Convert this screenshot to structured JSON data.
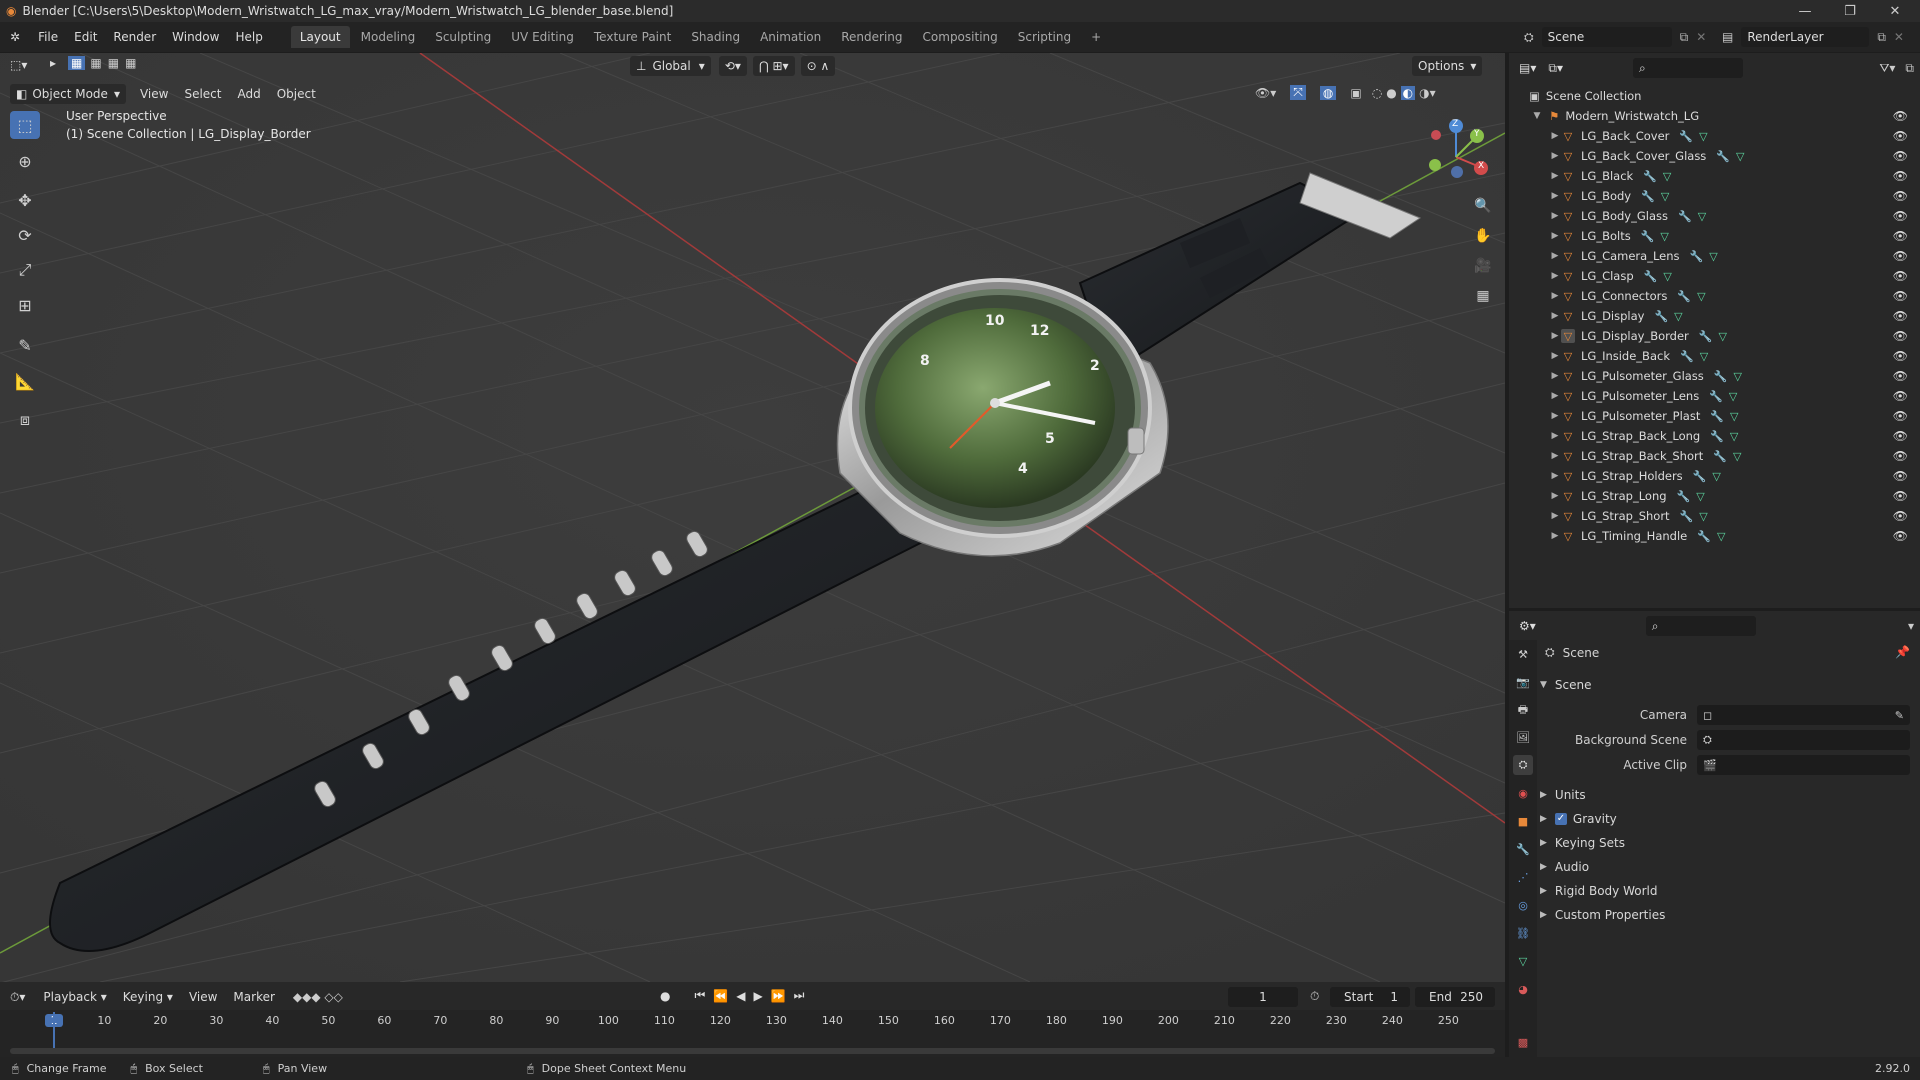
{
  "window": {
    "title": "Blender [C:\\Users\\5\\Desktop\\Modern_Wristwatch_LG_max_vray/Modern_Wristwatch_LG_blender_base.blend]",
    "minimize": "—",
    "maximize": "❐",
    "close": "✕"
  },
  "menu": [
    "File",
    "Edit",
    "Render",
    "Window",
    "Help"
  ],
  "workspaces": {
    "active": "Layout",
    "tabs": [
      "Layout",
      "Modeling",
      "Sculpting",
      "UV Editing",
      "Texture Paint",
      "Shading",
      "Animation",
      "Rendering",
      "Compositing",
      "Scripting"
    ],
    "add": "+"
  },
  "scene_field": "Scene",
  "renderlayer_field": "RenderLayer",
  "viewport": {
    "mode": "Object Mode",
    "menus": [
      "View",
      "Select",
      "Add",
      "Object"
    ],
    "transform": "Global",
    "options": "Options",
    "overlay_line1": "User Perspective",
    "overlay_line2": "(1) Scene Collection | LG_Display_Border",
    "gizmo": {
      "z": "Z",
      "y": "Y",
      "x": "X"
    }
  },
  "outliner": {
    "root": "Scene Collection",
    "collection": "Modern_Wristwatch_LG",
    "objects": [
      "LG_Back_Cover",
      "LG_Back_Cover_Glass",
      "LG_Black",
      "LG_Body",
      "LG_Body_Glass",
      "LG_Bolts",
      "LG_Camera_Lens",
      "LG_Clasp",
      "LG_Connectors",
      "LG_Display",
      "LG_Display_Border",
      "LG_Inside_Back",
      "LG_Pulsometer_Glass",
      "LG_Pulsometer_Lens",
      "LG_Pulsometer_Plast",
      "LG_Strap_Back_Long",
      "LG_Strap_Back_Short",
      "LG_Strap_Holders",
      "LG_Strap_Long",
      "LG_Strap_Short",
      "LG_Timing_Handle"
    ],
    "selected": "LG_Display_Border"
  },
  "properties": {
    "context": "Scene",
    "panel": "Scene",
    "camera_label": "Camera",
    "background_label": "Background Scene",
    "clip_label": "Active Clip",
    "sections": [
      "Units",
      "Gravity",
      "Keying Sets",
      "Audio",
      "Rigid Body World",
      "Custom Properties"
    ],
    "gravity_checked": true
  },
  "timeline": {
    "menus": [
      "Playback",
      "Keying",
      "View",
      "Marker"
    ],
    "current_frame": "1",
    "start_label": "Start",
    "start": "1",
    "end_label": "End",
    "end": "250",
    "ruler": [
      "1",
      "10",
      "20",
      "30",
      "40",
      "50",
      "60",
      "70",
      "80",
      "90",
      "100",
      "110",
      "120",
      "130",
      "140",
      "150",
      "160",
      "170",
      "180",
      "190",
      "200",
      "210",
      "220",
      "230",
      "240",
      "250"
    ]
  },
  "statusbar": {
    "item1": "Change Frame",
    "item2": "Box Select",
    "item3": "Pan View",
    "item4": "Dope Sheet Context Menu",
    "version": "2.92.0"
  },
  "colors": {
    "accent": "#4772b3",
    "object": "#e8893a",
    "modifier": "#6aa3e8",
    "mesh": "#5dd6a0"
  }
}
